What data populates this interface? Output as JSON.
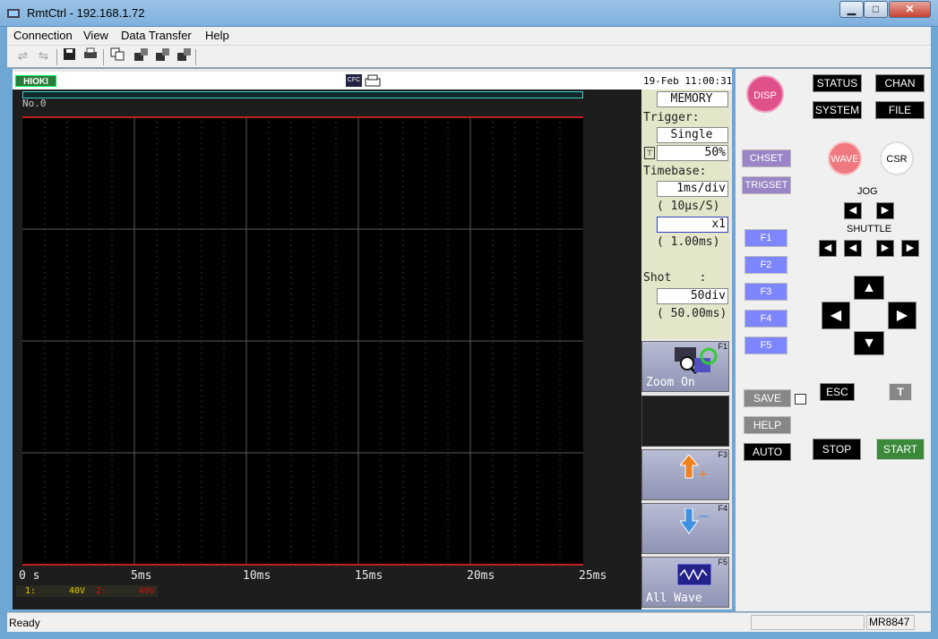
{
  "window": {
    "title": "RmtCtrl - 192.168.1.72",
    "minimize": "▁",
    "maximize": "□",
    "close": "✕"
  },
  "menu": {
    "items": [
      "Connection",
      "View",
      "Data Transfer",
      "Help"
    ]
  },
  "toolbar": {
    "icons": [
      "connect-icon",
      "disconnect-icon",
      "save-icon",
      "print-icon",
      "copy-screen-icon",
      "data-transfer-icon-1",
      "data-transfer-icon-2",
      "data-transfer-icon-3"
    ]
  },
  "screen": {
    "logo": "HIOKI",
    "cfc": "CFC",
    "datetime": "19-Feb 11:00:31",
    "record_no": "No.0",
    "time_ticks": [
      "0 s",
      "5ms",
      "10ms",
      "15ms",
      "20ms",
      "25ms"
    ],
    "channels": [
      {
        "label": "1:",
        "value": "40V",
        "color": "#e0d000"
      },
      {
        "label": "2:",
        "value": "40V",
        "color": "#d01010"
      }
    ],
    "settings": {
      "mode": "MEMORY",
      "trigger_label": "Trigger:",
      "trigger_mode": "Single",
      "pretrigger": "50%",
      "timebase_label": "Timebase:",
      "timebase": "1ms/div",
      "sampling": "(  10µs/S)",
      "magnification": "x1",
      "screen_time": "(  1.00ms)",
      "shot_label": "Shot    :",
      "shot": "50div",
      "shot_time": "( 50.00ms)"
    },
    "fkeys": {
      "f1": {
        "key": "F1",
        "label": "Zoom On"
      },
      "f3": {
        "key": "F3",
        "label": ""
      },
      "f4": {
        "key": "F4",
        "label": ""
      },
      "f5": {
        "key": "F5",
        "label": "All Wave"
      }
    }
  },
  "remote": {
    "disp": "DISP",
    "status": "STATUS",
    "chan": "CHAN",
    "system": "SYSTEM",
    "file": "FILE",
    "chset": "CHSET",
    "trigset": "TRIGSET",
    "wave": "WAVE",
    "csr": "CSR",
    "jog": "JOG",
    "shuttle": "SHUTTLE",
    "f_buttons": [
      "F1",
      "F2",
      "F3",
      "F4",
      "F5"
    ],
    "save": "SAVE",
    "esc": "ESC",
    "help": "HELP",
    "auto": "AUTO",
    "stop": "STOP",
    "start": "START",
    "colors": {
      "disp": "#e0508a",
      "wave": "#f07880",
      "start": "#3a8a3a"
    }
  },
  "statusbar": {
    "status": "Ready",
    "model": "MR8847"
  }
}
